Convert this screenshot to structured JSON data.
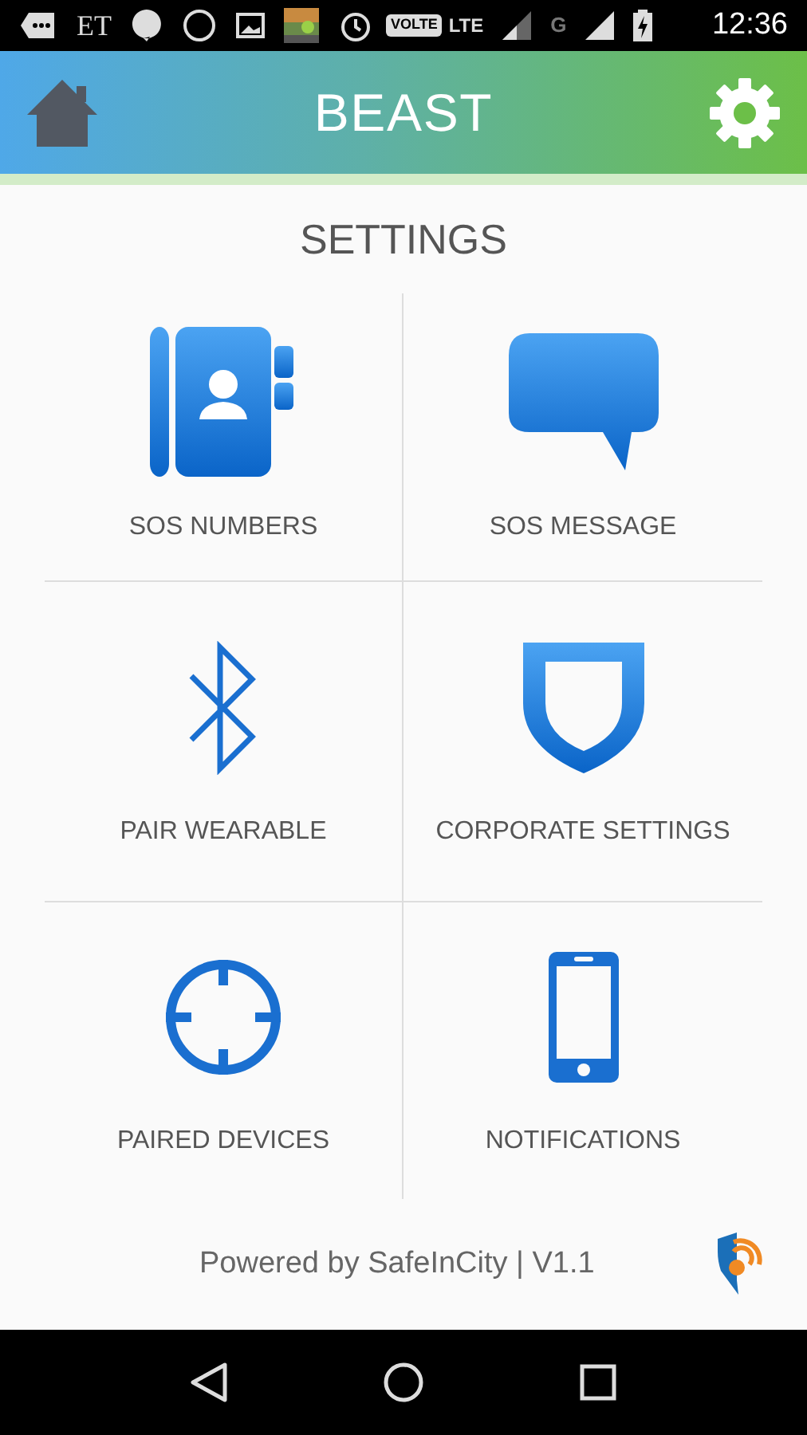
{
  "status_bar": {
    "left_texts": [
      "ET"
    ],
    "network_badge": "VOLTE",
    "network_type": "LTE",
    "secondary_network": "G",
    "time": "12:36"
  },
  "header": {
    "title": "BEAST"
  },
  "page_title": "SETTINGS",
  "items": [
    {
      "label": "SOS NUMBERS",
      "kind": "contacts"
    },
    {
      "label": "SOS MESSAGE",
      "kind": "message"
    },
    {
      "label": "PAIR WEARABLE",
      "kind": "bluetooth"
    },
    {
      "label": "CORPORATE SETTINGS",
      "kind": "shield"
    },
    {
      "label": "PAIRED DEVICES",
      "kind": "crosshair"
    },
    {
      "label": "NOTIFICATIONS",
      "kind": "phone"
    }
  ],
  "footer": {
    "text": "Powered by SafeInCity | V1.1"
  }
}
